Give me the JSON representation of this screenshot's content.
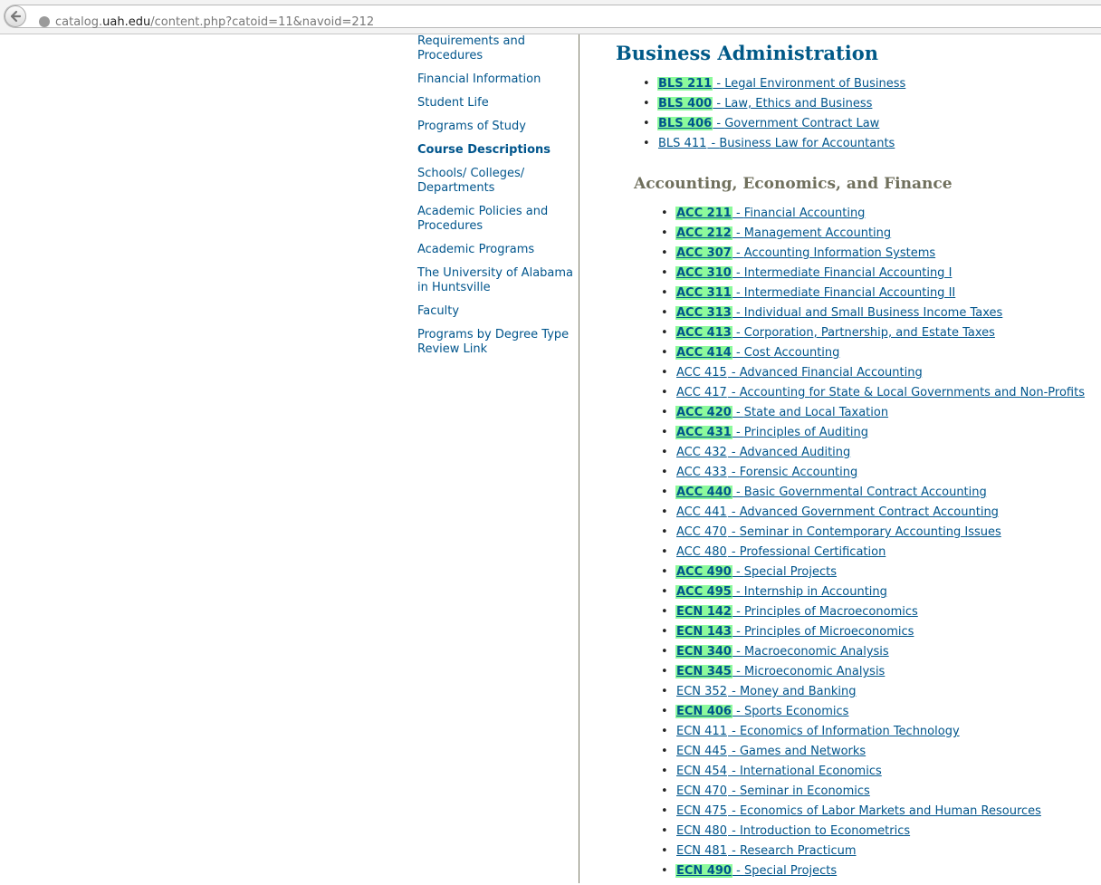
{
  "browser": {
    "url_host_prefix": "catalog.",
    "url_host": "uah.edu",
    "url_path": "/content.php?catoid=11&navoid=212"
  },
  "sidebar": {
    "items": [
      {
        "label": "Requirements and Procedures",
        "active": false
      },
      {
        "label": "Financial Information",
        "active": false
      },
      {
        "label": "Student Life",
        "active": false
      },
      {
        "label": "Programs of Study",
        "active": false
      },
      {
        "label": "Course Descriptions",
        "active": true
      },
      {
        "label": "Schools/ Colleges/ Departments",
        "active": false
      },
      {
        "label": "Academic Policies and Procedures",
        "active": false
      },
      {
        "label": "Academic Programs",
        "active": false
      },
      {
        "label": "The University of Alabama in Huntsville",
        "active": false
      },
      {
        "label": "Faculty",
        "active": false
      },
      {
        "label": "Programs by Degree Type Review Link",
        "active": false
      }
    ]
  },
  "sections": [
    {
      "heading": "Business Administration",
      "courses": [
        {
          "code": "BLS 211",
          "title": "Legal Environment of Business",
          "highlighted": true
        },
        {
          "code": "BLS 400",
          "title": "Law, Ethics and Business",
          "highlighted": true
        },
        {
          "code": "BLS 406",
          "title": "Government Contract Law",
          "highlighted": true
        },
        {
          "code": "BLS 411",
          "title": "Business Law for Accountants",
          "highlighted": false
        }
      ]
    },
    {
      "heading": "Accounting, Economics, and Finance",
      "courses": [
        {
          "code": "ACC 211",
          "title": "Financial Accounting",
          "highlighted": true
        },
        {
          "code": "ACC 212",
          "title": "Management Accounting",
          "highlighted": true
        },
        {
          "code": "ACC 307",
          "title": "Accounting Information Systems",
          "highlighted": true
        },
        {
          "code": "ACC 310",
          "title": "Intermediate Financial Accounting I",
          "highlighted": true
        },
        {
          "code": "ACC 311",
          "title": "Intermediate Financial Accounting II",
          "highlighted": true
        },
        {
          "code": "ACC 313",
          "title": "Individual and Small Business Income Taxes",
          "highlighted": true
        },
        {
          "code": "ACC 413",
          "title": "Corporation, Partnership, and Estate Taxes",
          "highlighted": true
        },
        {
          "code": "ACC 414",
          "title": "Cost Accounting",
          "highlighted": true
        },
        {
          "code": "ACC 415",
          "title": "Advanced Financial Accounting",
          "highlighted": false
        },
        {
          "code": "ACC 417",
          "title": "Accounting for State & Local Governments and Non-Profits",
          "highlighted": false
        },
        {
          "code": "ACC 420",
          "title": "State and Local Taxation",
          "highlighted": true
        },
        {
          "code": "ACC 431",
          "title": "Principles of Auditing",
          "highlighted": true
        },
        {
          "code": "ACC 432",
          "title": "Advanced Auditing",
          "highlighted": false
        },
        {
          "code": "ACC 433",
          "title": "Forensic Accounting",
          "highlighted": false
        },
        {
          "code": "ACC 440",
          "title": "Basic Governmental Contract Accounting",
          "highlighted": true
        },
        {
          "code": "ACC 441",
          "title": "Advanced Government Contract Accounting",
          "highlighted": false
        },
        {
          "code": "ACC 470",
          "title": "Seminar in Contemporary Accounting Issues",
          "highlighted": false
        },
        {
          "code": "ACC 480",
          "title": "Professional Certification",
          "highlighted": false
        },
        {
          "code": "ACC 490",
          "title": "Special Projects",
          "highlighted": true
        },
        {
          "code": "ACC 495",
          "title": "Internship in Accounting",
          "highlighted": true
        },
        {
          "code": "ECN 142",
          "title": "Principles of Macroeconomics",
          "highlighted": true
        },
        {
          "code": "ECN 143",
          "title": "Principles of Microeconomics",
          "highlighted": true
        },
        {
          "code": "ECN 340",
          "title": "Macroeconomic Analysis",
          "highlighted": true
        },
        {
          "code": "ECN 345",
          "title": "Microeconomic Analysis",
          "highlighted": true
        },
        {
          "code": "ECN 352",
          "title": "Money and Banking",
          "highlighted": false
        },
        {
          "code": "ECN 406",
          "title": "Sports Economics",
          "highlighted": true
        },
        {
          "code": "ECN 411",
          "title": "Economics of Information Technology",
          "highlighted": false
        },
        {
          "code": "ECN 445",
          "title": "Games and Networks",
          "highlighted": false
        },
        {
          "code": "ECN 454",
          "title": "International Economics",
          "highlighted": false
        },
        {
          "code": "ECN 470",
          "title": "Seminar in Economics",
          "highlighted": false
        },
        {
          "code": "ECN 475",
          "title": "Economics of Labor Markets and Human Resources",
          "highlighted": false
        },
        {
          "code": "ECN 480",
          "title": "Introduction to Econometrics",
          "highlighted": false
        },
        {
          "code": "ECN 481",
          "title": "Research Practicum",
          "highlighted": false
        },
        {
          "code": "ECN 490",
          "title": "Special Projects",
          "highlighted": true
        }
      ]
    }
  ],
  "separator": " - ",
  "bullet": "•",
  "colors": {
    "link": "#00558c",
    "heading_primary": "#005987",
    "heading_secondary": "#6f6f5c",
    "highlight": "#8cfa9c"
  }
}
